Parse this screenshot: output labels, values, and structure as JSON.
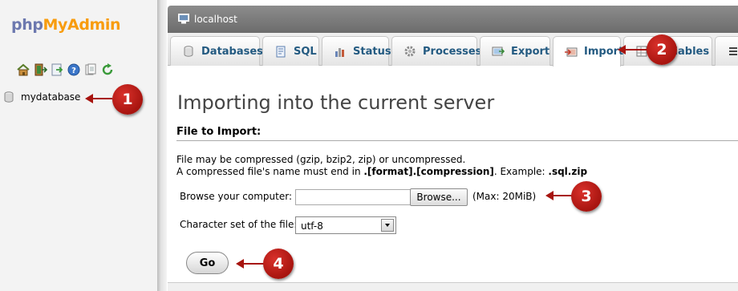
{
  "app": {
    "logo_part1": "php",
    "logo_part2": "MyAdmin"
  },
  "nav": {
    "icons": [
      "home-icon",
      "exit-icon",
      "sql-query-icon",
      "help-icon",
      "docs-icon",
      "reload-icon"
    ],
    "databases": [
      {
        "label": "mydatabase"
      }
    ]
  },
  "server": {
    "label": "localhost"
  },
  "tabs": [
    {
      "label": "Databases",
      "icon": "database-icon"
    },
    {
      "label": "SQL",
      "icon": "sql-icon"
    },
    {
      "label": "Status",
      "icon": "status-icon"
    },
    {
      "label": "Processes",
      "icon": "processes-icon"
    },
    {
      "label": "Export",
      "icon": "export-icon"
    },
    {
      "label": "Import",
      "icon": "import-icon",
      "active": true
    },
    {
      "label": "Variables",
      "icon": "variables-icon"
    },
    {
      "label": "",
      "icon": "more-icon"
    }
  ],
  "main": {
    "title": "Importing into the current server",
    "section_title": "File to Import:",
    "info_line1": "File may be compressed (gzip, bzip2, zip) or uncompressed.",
    "info_line2_prefix": "A compressed file's name must end in ",
    "info_line2_format": ".[format].[compression]",
    "info_line2_middle": ". Example: ",
    "info_line2_example": ".sql.zip",
    "browse_label": "Browse your computer:",
    "browse_button": "Browse...",
    "max_size": "(Max: 20MiB)",
    "charset_label": "Character set of the file:",
    "charset_value": "utf-8",
    "go_button": "Go"
  },
  "markers": [
    "1",
    "2",
    "3",
    "4"
  ],
  "colors": {
    "marker": "#a7140f",
    "tab_text": "#235a81",
    "logo_php": "#6c78af",
    "logo_myadmin": "#f89c0e"
  }
}
